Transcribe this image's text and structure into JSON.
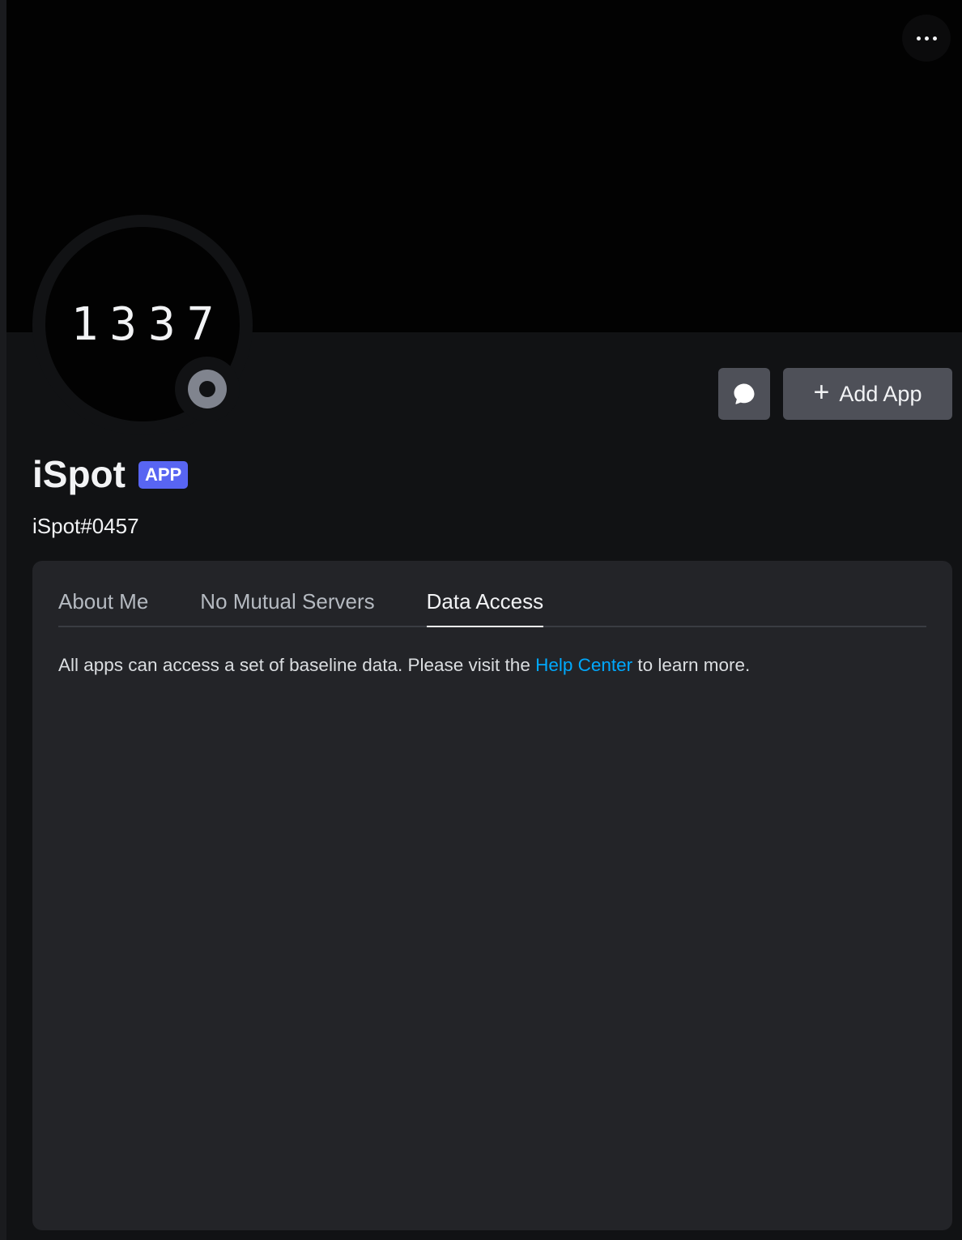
{
  "header": {
    "more_icon": "ellipsis-icon"
  },
  "avatar": {
    "text": "1337",
    "status": "offline"
  },
  "actions": {
    "message_icon": "chat-bubble-icon",
    "add_app_icon": "plus-icon",
    "add_app_label": "Add App"
  },
  "profile": {
    "display_name": "iSpot",
    "badge": "APP",
    "username": "iSpot#0457"
  },
  "tabs": [
    {
      "label": "About Me",
      "active": false
    },
    {
      "label": "No Mutual Servers",
      "active": false
    },
    {
      "label": "Data Access",
      "active": true
    }
  ],
  "data_access": {
    "text_before": "All apps can access a set of baseline data. Please visit the ",
    "link_text": "Help Center",
    "text_after": " to learn more."
  },
  "colors": {
    "accent": "#5865f2",
    "link": "#00a8fc",
    "panel": "#232428",
    "background": "#111214"
  }
}
